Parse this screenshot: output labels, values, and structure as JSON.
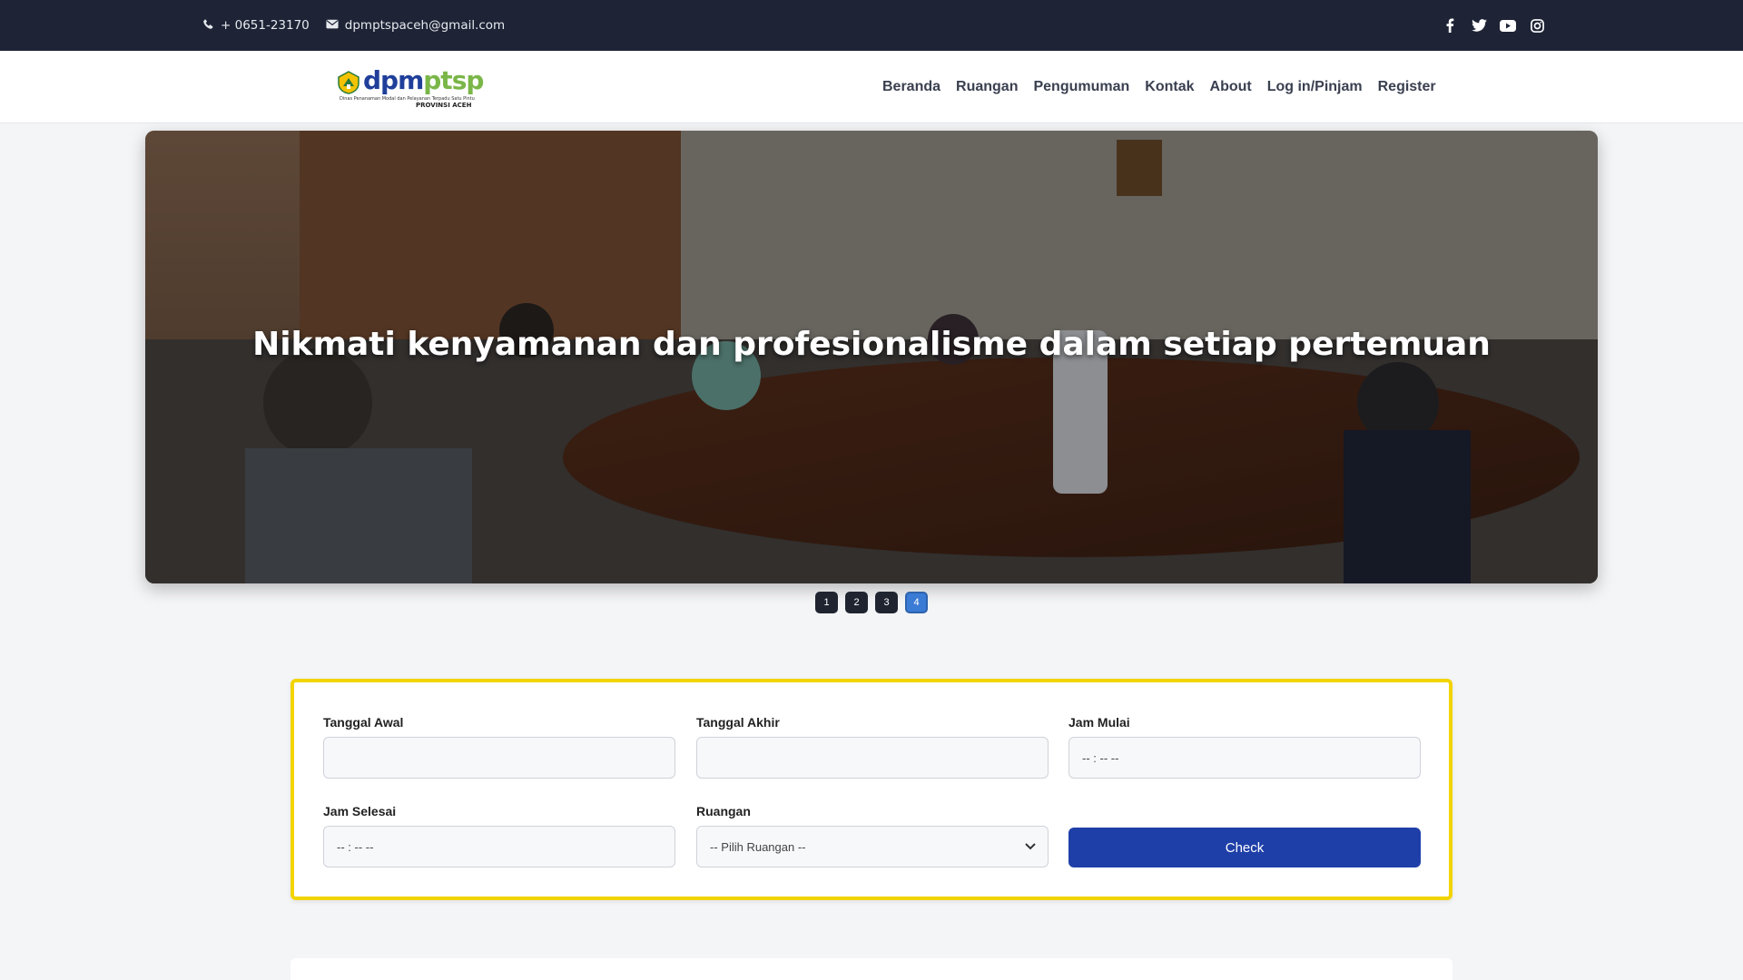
{
  "topbar": {
    "phone": "+ 0651-23170",
    "email": "dpmptspaceh@gmail.com",
    "social_icons": [
      "facebook-icon",
      "twitter-icon",
      "youtube-icon",
      "instagram-icon"
    ]
  },
  "logo": {
    "wordmark_a": "dpm",
    "wordmark_b": "ptsp",
    "subtitle": "Dinas Penanaman Modal dan Pelayanan Terpadu Satu Pintu",
    "region": "PROVINSI ACEH"
  },
  "nav": {
    "items": [
      "Beranda",
      "Ruangan",
      "Pengumuman",
      "Kontak",
      "About",
      "Log in/Pinjam",
      "Register"
    ]
  },
  "hero": {
    "caption": "Nikmati kenyamanan dan profesionalisme dalam setiap pertemuan"
  },
  "carousel": {
    "pages": [
      "1",
      "2",
      "3",
      "4"
    ],
    "active_index": 3
  },
  "form": {
    "tanggal_awal_label": "Tanggal Awal",
    "tanggal_awal_value": "",
    "tanggal_akhir_label": "Tanggal Akhir",
    "tanggal_akhir_value": "",
    "jam_mulai_label": "Jam Mulai",
    "jam_mulai_value": "-- : --  --",
    "jam_selesai_label": "Jam Selesai",
    "jam_selesai_value": "-- : --  --",
    "ruangan_label": "Ruangan",
    "ruangan_selected": "-- Pilih Ruangan --",
    "check_label": "Check"
  },
  "colors": {
    "topbar_bg": "#1e2436",
    "accent_yellow": "#f2d400",
    "button_blue": "#1f3fa8",
    "active_dot": "#3a7bd5"
  }
}
